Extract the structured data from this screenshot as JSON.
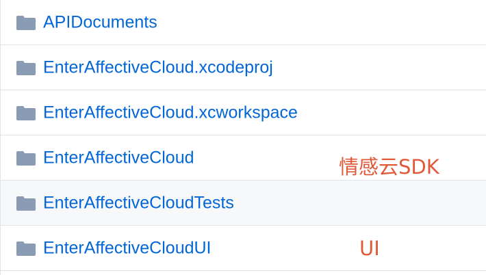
{
  "annotation_color": "#e05a3a",
  "link_color": "#0366d6",
  "folder_icon_color": "#8a9cb4",
  "files": [
    {
      "name": "APIDocuments",
      "type": "folder",
      "icon": "folder-icon"
    },
    {
      "name": "EnterAffectiveCloud.xcodeproj",
      "type": "folder",
      "icon": "folder-icon"
    },
    {
      "name": "EnterAffectiveCloud.xcworkspace",
      "type": "folder",
      "icon": "folder-icon"
    },
    {
      "name": "EnterAffectiveCloud",
      "type": "folder",
      "icon": "folder-icon"
    },
    {
      "name": "EnterAffectiveCloudTests",
      "type": "folder",
      "icon": "folder-icon"
    },
    {
      "name": "EnterAffectiveCloudUI",
      "type": "folder",
      "icon": "folder-icon"
    }
  ],
  "annotations": {
    "sdk": "情感云SDK",
    "ui": "UI"
  }
}
